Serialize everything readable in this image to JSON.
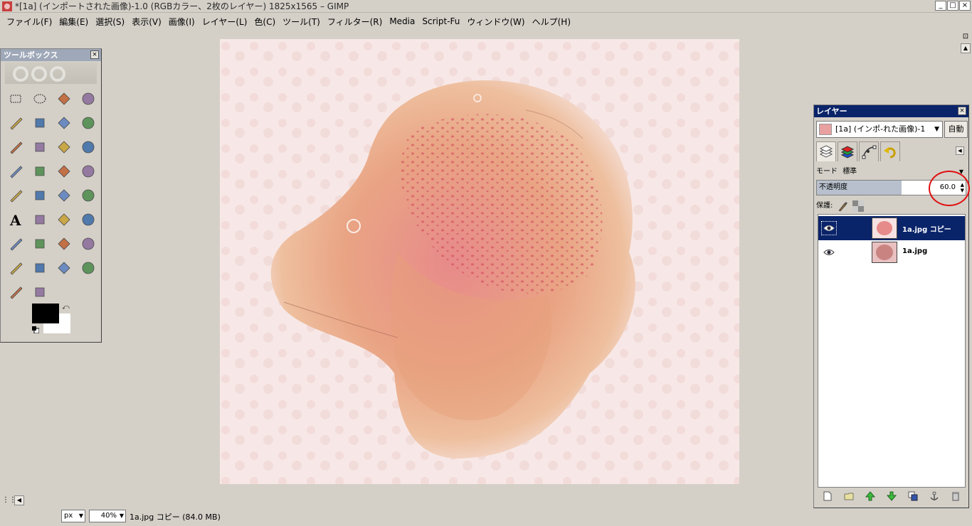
{
  "window": {
    "title": "*[1a] (インポートされた画像)-1.0 (RGBカラー、2枚のレイヤー) 1825x1565 – GIMP",
    "minimize_label": "_",
    "maximize_label": "□",
    "close_label": "×"
  },
  "menubar": {
    "items": [
      {
        "label": "ファイル(F)"
      },
      {
        "label": "編集(E)"
      },
      {
        "label": "選択(S)"
      },
      {
        "label": "表示(V)"
      },
      {
        "label": "画像(I)"
      },
      {
        "label": "レイヤー(L)"
      },
      {
        "label": "色(C)"
      },
      {
        "label": "ツール(T)"
      },
      {
        "label": "フィルター(R)"
      },
      {
        "label": "Media"
      },
      {
        "label": "Script-Fu"
      },
      {
        "label": "ウィンドウ(W)"
      },
      {
        "label": "ヘルプ(H)"
      }
    ]
  },
  "toolbox": {
    "title": "ツールボックス",
    "close_label": "×",
    "tools": [
      "rect-select-icon",
      "ellipse-select-icon",
      "free-select-icon",
      "fuzzy-select-icon",
      "color-select-icon",
      "scissors-select-icon",
      "foreground-select-icon",
      "paths-icon",
      "color-picker-icon",
      "zoom-icon",
      "measure-icon",
      "move-icon",
      "align-icon",
      "crop-icon",
      "rotate-icon",
      "scale-icon",
      "shear-icon",
      "perspective-icon",
      "flip-icon",
      "cage-transform-icon",
      "text-icon",
      "bucket-fill-icon",
      "blend-icon",
      "pencil-icon",
      "paintbrush-icon",
      "eraser-icon",
      "airbrush-icon",
      "ink-icon",
      "clone-icon",
      "heal-icon",
      "perspective-clone-icon",
      "blur-sharpen-icon",
      "smudge-icon",
      "dodge-burn-icon"
    ],
    "foreground_color": "#000000",
    "background_color": "#ffffff"
  },
  "layers_dialog": {
    "title": "レイヤー",
    "close_label": "×",
    "image_menu": "[1a] (インポ-れた画像)-1",
    "auto_button": "自動",
    "mode_label": "モード",
    "mode_value": "標準",
    "opacity_label": "不透明度",
    "opacity_value": "60.0",
    "lock_label": "保護:",
    "layers": [
      {
        "name": "1a.jpg コピー",
        "visible": true,
        "selected": true
      },
      {
        "name": "1a.jpg",
        "visible": true,
        "selected": false
      }
    ]
  },
  "statusbar": {
    "unit": "px",
    "zoom": "40%",
    "status": "1a.jpg コピー (84.0 MB)"
  },
  "accent": {
    "selection": "#0a246a",
    "annotation_circle": "#e01010"
  }
}
